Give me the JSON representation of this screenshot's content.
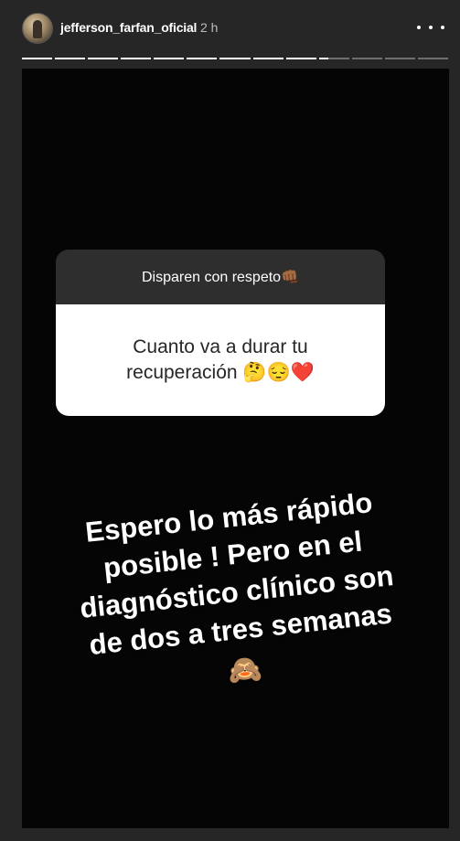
{
  "header": {
    "username": "jefferson_farfan_oficial",
    "time_ago": "2 h",
    "more_icon": "more-horizontal-icon"
  },
  "progress": {
    "segments_total": 13,
    "segments_done": 9,
    "current_segment_fraction": 0.3
  },
  "question_sticker": {
    "prompt": "Disparen con respeto👊🏾",
    "question": "Cuanto va a durar tu recuperación 🤔😔❤️"
  },
  "answer_lines": [
    "Espero lo más rápido",
    "posible ! Pero en el",
    "diagnóstico clínico  son",
    "de dos a tres semanas"
  ],
  "answer_emoji": "🙈",
  "colors": {
    "background": "#262626",
    "story_bg": "#050505",
    "progress_done": "#ffffff",
    "progress_pending": "#6e6e6e"
  }
}
